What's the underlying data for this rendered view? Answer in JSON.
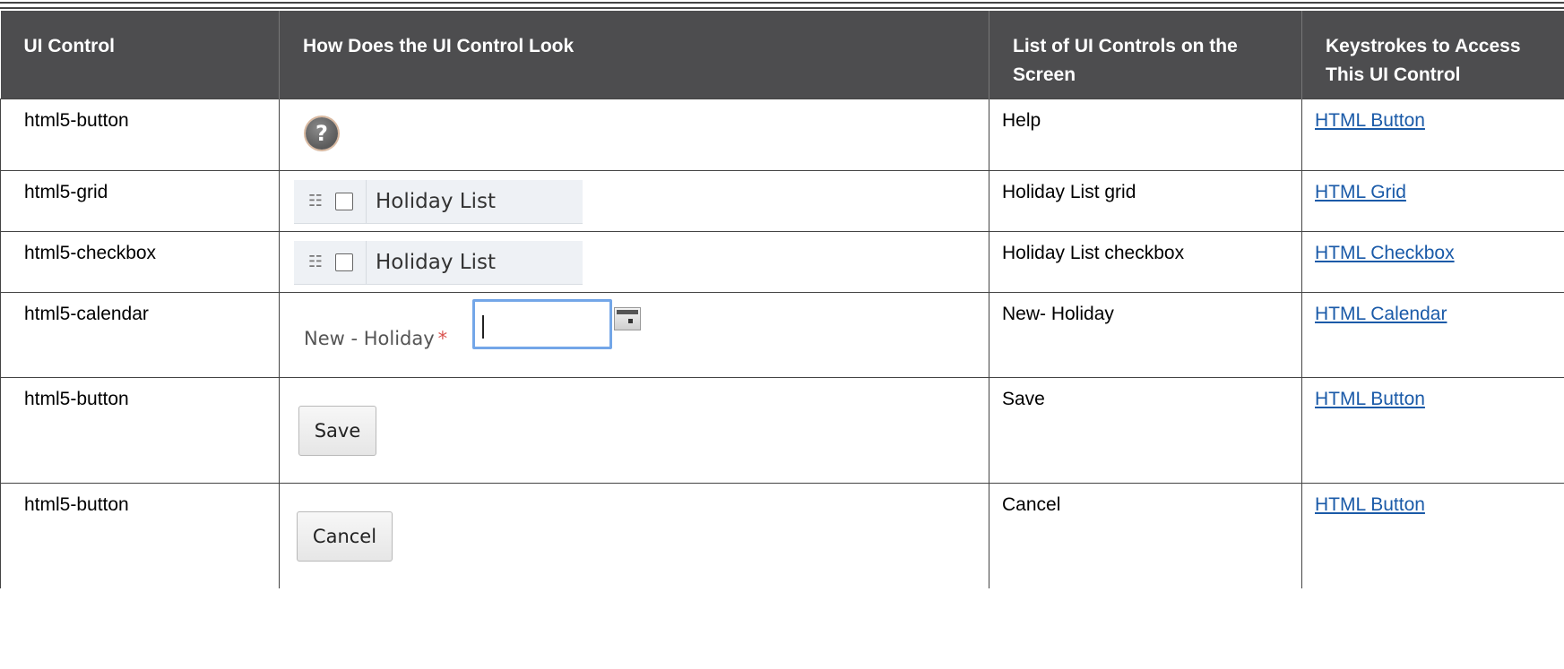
{
  "table": {
    "headers": [
      "UI Control",
      "How Does the UI Control Look",
      "List of UI Controls on the Screen",
      "Keystrokes to Access This UI Control"
    ],
    "rows": [
      {
        "control": "html5-button",
        "visual": {
          "type": "help-icon",
          "icon": "question-mark-icon",
          "glyph": "?"
        },
        "list": "Help",
        "link": "HTML Button"
      },
      {
        "control": "html5-grid",
        "visual": {
          "type": "grid-header",
          "label": "Holiday List"
        },
        "list": "Holiday List grid",
        "link": "HTML Grid"
      },
      {
        "control": "html5-checkbox",
        "visual": {
          "type": "grid-header",
          "label": "Holiday List"
        },
        "list": "Holiday List checkbox",
        "link": "HTML Checkbox"
      },
      {
        "control": "html5-calendar",
        "visual": {
          "type": "calendar-field",
          "label": "New - Holiday",
          "required": "*"
        },
        "list": "New- Holiday",
        "link": "HTML Calendar"
      },
      {
        "control": "html5-button",
        "visual": {
          "type": "button",
          "label": "Save"
        },
        "list": "Save",
        "link": "HTML Button"
      },
      {
        "control": "html5-button",
        "visual": {
          "type": "button",
          "label": "Cancel"
        },
        "list": "Cancel",
        "link": "HTML Button"
      }
    ]
  },
  "colors": {
    "header_bg": "#4d4d4f",
    "link": "#1a5aa8",
    "required": "#d9534f",
    "focus_border": "#73a6e8"
  }
}
